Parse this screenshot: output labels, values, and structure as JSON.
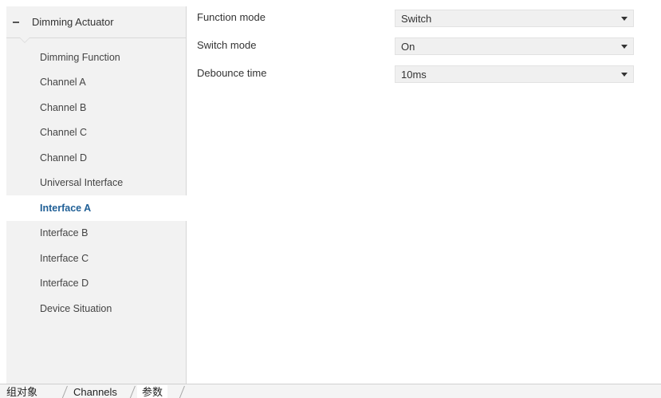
{
  "sidebar": {
    "header": {
      "label": "Dimming Actuator"
    },
    "items": [
      {
        "label": "Dimming Function"
      },
      {
        "label": "Channel A"
      },
      {
        "label": "Channel B"
      },
      {
        "label": "Channel C"
      },
      {
        "label": "Channel D"
      },
      {
        "label": "Universal Interface"
      },
      {
        "label": "Interface A",
        "selected": true
      },
      {
        "label": "Interface B"
      },
      {
        "label": "Interface C"
      },
      {
        "label": "Interface D"
      },
      {
        "label": "Device Situation"
      }
    ]
  },
  "params": [
    {
      "label": "Function mode",
      "value": "Switch"
    },
    {
      "label": "Switch mode",
      "value": "On"
    },
    {
      "label": "Debounce time",
      "value": "10ms"
    }
  ],
  "tabs": [
    {
      "label": "组对象"
    },
    {
      "label": "Channels"
    },
    {
      "label": "参数",
      "active": true
    }
  ],
  "colors": {
    "selected_text": "#1f5f96",
    "sidebar_bg": "#f2f2f2",
    "select_bg": "#f0f0f0"
  },
  "icons": {
    "collapse": "minus-icon",
    "dropdown": "caret-down-icon"
  }
}
